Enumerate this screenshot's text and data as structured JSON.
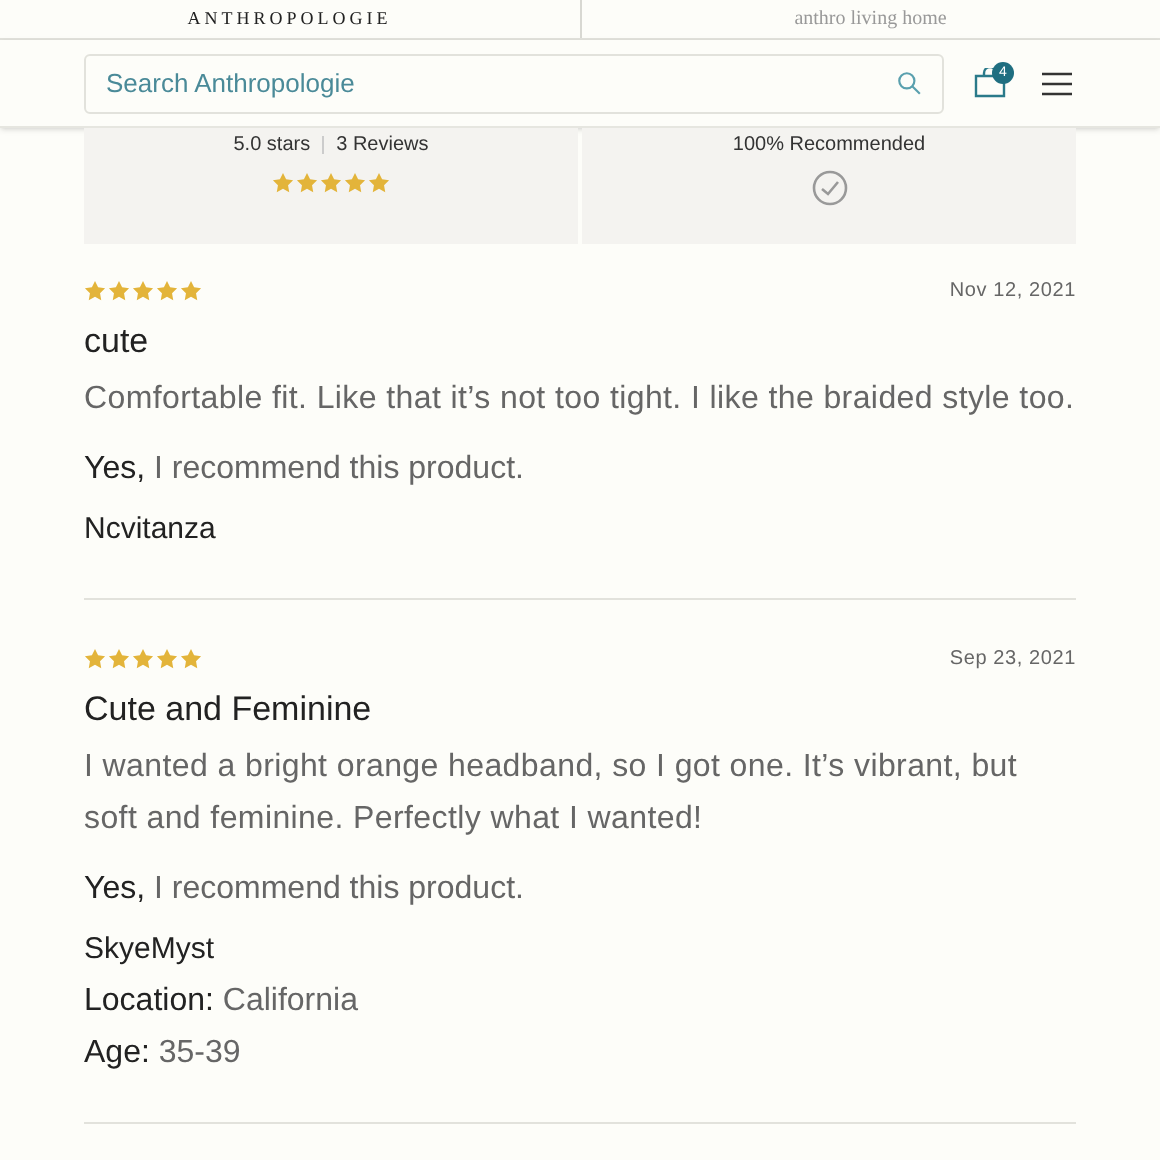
{
  "header": {
    "brands": [
      "ANTHROPOLOGIE",
      "anthro living home"
    ]
  },
  "search": {
    "placeholder": "Search Anthropologie"
  },
  "cart": {
    "count": "4"
  },
  "summary": {
    "rating": "5.0 stars",
    "reviews": "3 Reviews",
    "stars": 5,
    "recommended": "100% Recommended"
  },
  "reviews": [
    {
      "stars": 5,
      "date": "Nov 12, 2021",
      "title": "cute",
      "body": "Comfortable fit. Like that it’s not too tight. I like the braided style too.",
      "recommend": "**Yes,** I recommend this product.",
      "author": "Ncvitanza"
    },
    {
      "stars": 5,
      "date": "Sep 23, 2021",
      "title": "Cute and Feminine",
      "body": "I wanted a bright orange headband, so I got one. It’s vibrant, but soft and feminine. Perfectly what I wanted!",
      "recommend": "**Yes,** I recommend this product.",
      "author": "SkyeMyst",
      "details": [
        "**Location:** California",
        "**Age:** 35-39"
      ]
    }
  ]
}
